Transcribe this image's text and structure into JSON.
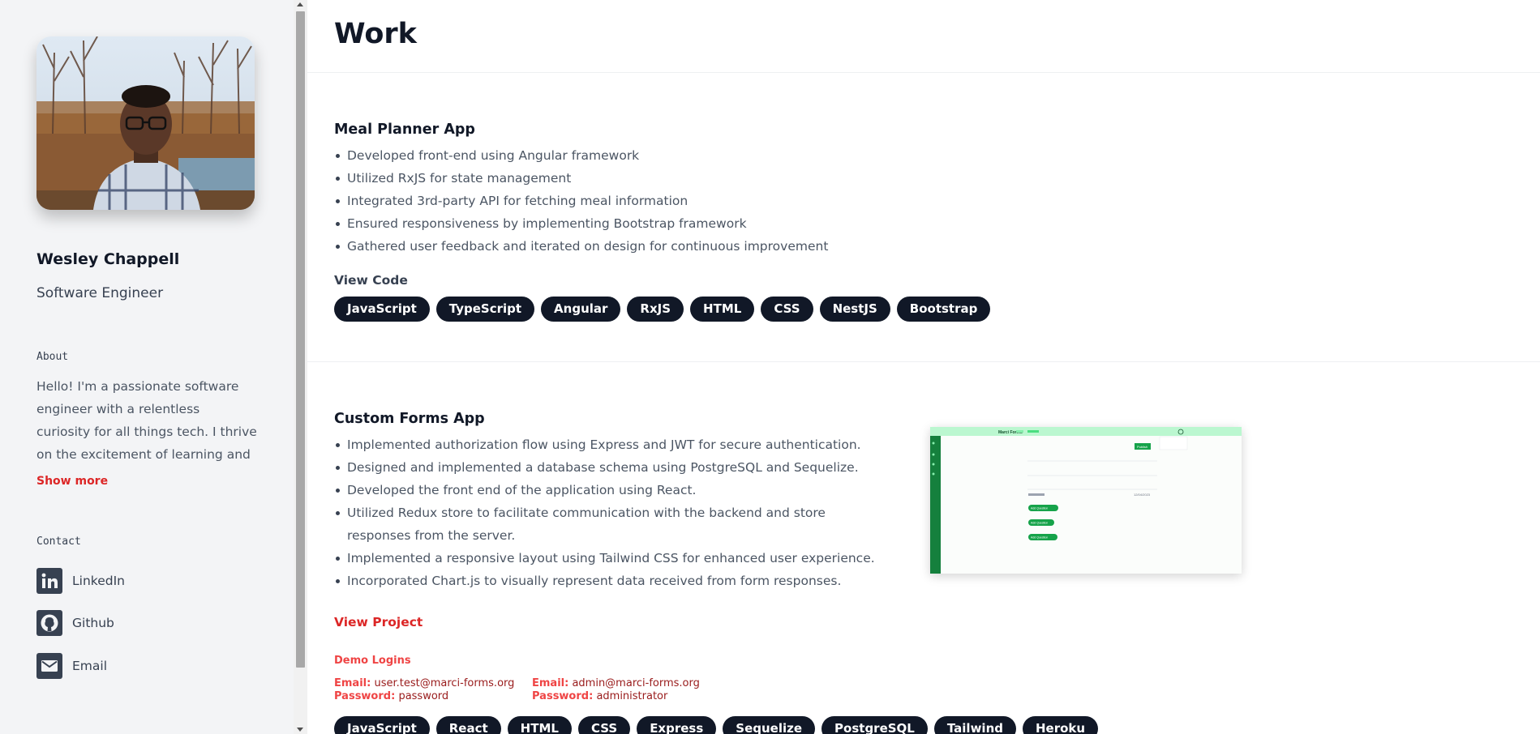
{
  "profile": {
    "name": "Wesley Chappell",
    "role": "Software Engineer"
  },
  "about": {
    "label": "About",
    "text": "Hello! I'm a passionate software engineer with a relentless curiosity for all things tech. I thrive on the excitement of learning and embraci...",
    "show_more": "Show more"
  },
  "contact": {
    "label": "Contact",
    "items": [
      {
        "label": "LinkedIn",
        "icon": "linkedin-icon"
      },
      {
        "label": "Github",
        "icon": "github-icon"
      },
      {
        "label": "Email",
        "icon": "email-icon"
      }
    ]
  },
  "main": {
    "title": "Work",
    "projects": [
      {
        "title": "Meal Planner App",
        "bullets": [
          "Developed front-end using Angular framework",
          "Utilized RxJS for state management",
          "Integrated 3rd-party API for fetching meal information",
          "Ensured responsiveness by implementing Bootstrap framework",
          "Gathered user feedback and iterated on design for continuous improvement"
        ],
        "link_label": "View Code",
        "tags": [
          "JavaScript",
          "TypeScript",
          "Angular",
          "RxJS",
          "HTML",
          "CSS",
          "NestJS",
          "Bootstrap"
        ]
      },
      {
        "title": "Custom Forms App",
        "bullets": [
          "Implemented authorization flow using Express and JWT for secure authentication.",
          "Designed and implemented a database schema using PostgreSQL and Sequelize.",
          "Developed the front end of the application using React.",
          "Utilized Redux store to facilitate communication with the backend and store responses from the server.",
          "Implemented a responsive layout using Tailwind CSS for enhanced user experience.",
          "Incorporated Chart.js to visually represent data received from form responses."
        ],
        "link_label": "View Project",
        "demo": {
          "heading": "Demo Logins",
          "logins": [
            {
              "email_key": "Email:",
              "email": "user.test@marci-forms.org",
              "password_key": "Password:",
              "password": "password"
            },
            {
              "email_key": "Email:",
              "email": "admin@marci-forms.org",
              "password_key": "Password:",
              "password": "administrator"
            }
          ]
        },
        "tags": [
          "JavaScript",
          "React",
          "HTML",
          "CSS",
          "Express",
          "Sequelize",
          "PostgreSQL",
          "Tailwind",
          "Heroku"
        ],
        "preview": {
          "brand": "Marci Forms",
          "publish_label": "Publish",
          "date": "12/04/2023",
          "buttons": [
            "Add Question",
            "Add Question",
            "Add Question"
          ]
        }
      }
    ]
  },
  "colors": {
    "accent_red": "#dc2626",
    "tag_bg": "#111827",
    "sidebar_bg": "#f3f4f6",
    "preview_green": "#15803d"
  }
}
